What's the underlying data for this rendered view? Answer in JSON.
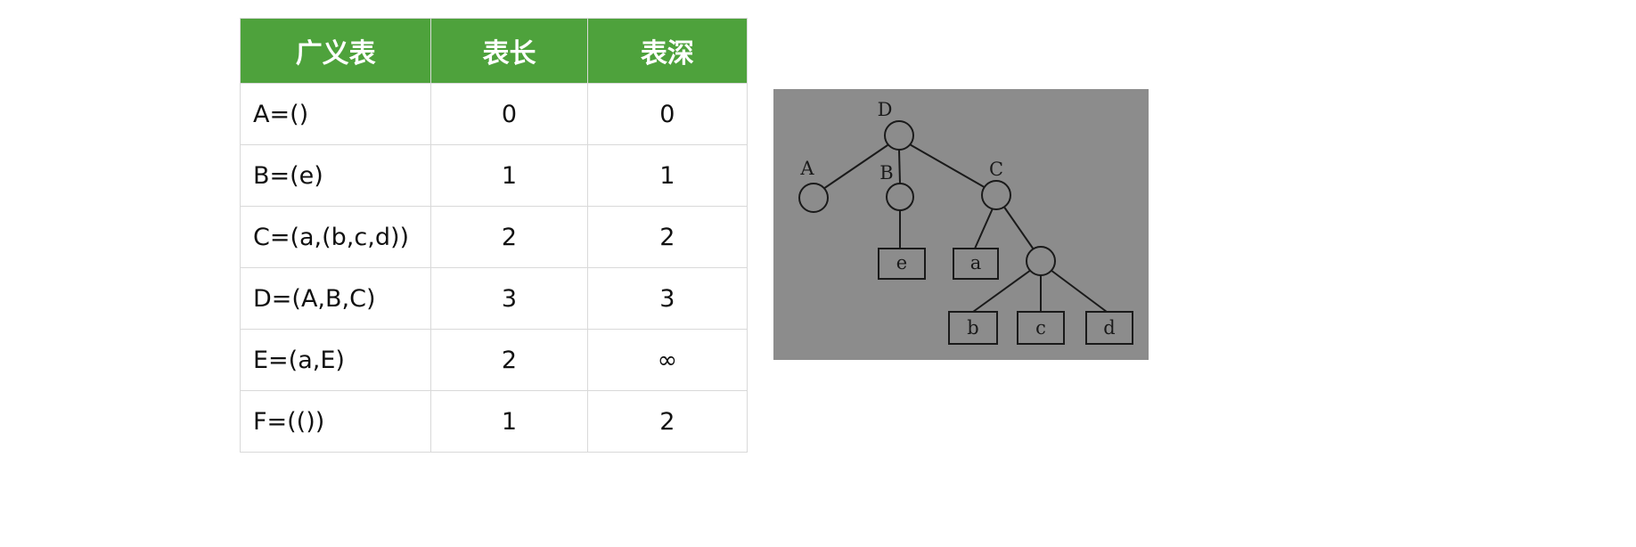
{
  "table": {
    "headers": [
      "广义表",
      "表长",
      "表深"
    ],
    "rows": [
      {
        "list": "A=()",
        "length": "0",
        "depth": "0"
      },
      {
        "list": "B=(e)",
        "length": "1",
        "depth": "1"
      },
      {
        "list": "C=(a,(b,c,d))",
        "length": "2",
        "depth": "2"
      },
      {
        "list": "D=(A,B,C)",
        "length": "3",
        "depth": "3"
      },
      {
        "list": "E=(a,E)",
        "length": "2",
        "depth": "∞"
      },
      {
        "list": "F=(())",
        "length": "1",
        "depth": "2"
      }
    ]
  },
  "tree": {
    "background": "#8c8c8c",
    "node_labels": {
      "D": "D",
      "A": "A",
      "B": "B",
      "C": "C"
    },
    "leaf_labels": {
      "e": "e",
      "a": "a",
      "b": "b",
      "c": "c",
      "d": "d"
    }
  }
}
